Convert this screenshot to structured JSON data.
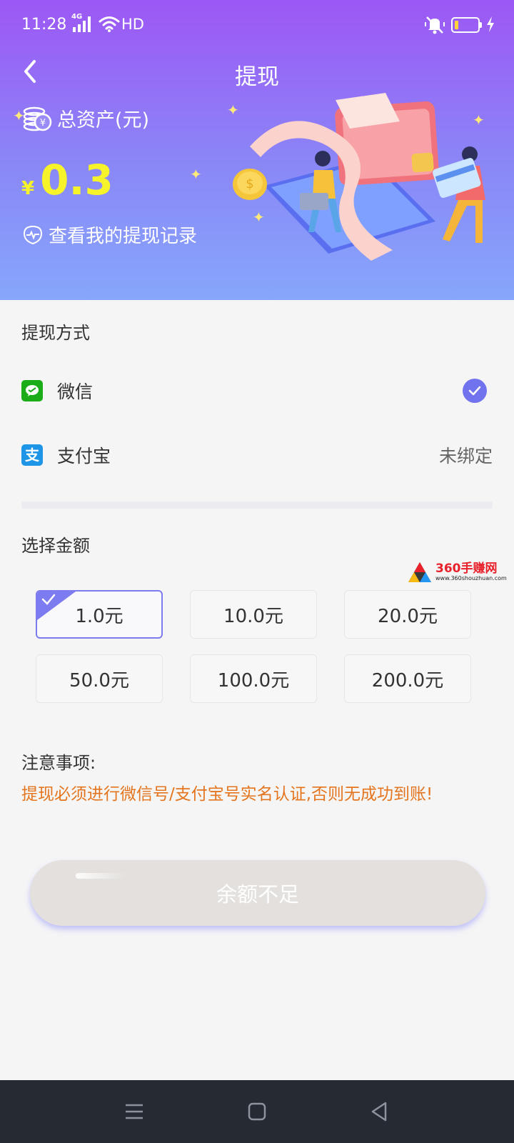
{
  "status_bar": {
    "time": "11:28",
    "network": "4G",
    "hd": "HD"
  },
  "header": {
    "title": "提现",
    "total_assets_label": "总资产(元)",
    "currency_symbol": "¥",
    "balance": "0.3",
    "record_link": "查看我的提现记录"
  },
  "withdraw_method": {
    "section_title": "提现方式",
    "options": [
      {
        "label": "微信",
        "icon": "wechat-icon",
        "selected": true,
        "status": ""
      },
      {
        "label": "支付宝",
        "icon": "alipay-icon",
        "selected": false,
        "status": "未绑定"
      }
    ]
  },
  "amount": {
    "section_title": "选择金额",
    "options": [
      "1.0元",
      "10.0元",
      "20.0元",
      "50.0元",
      "100.0元",
      "200.0元"
    ],
    "selected_index": 0
  },
  "watermark": {
    "brand": "360手赚网",
    "url": "www.360shouzhuan.com"
  },
  "notes": {
    "title": "注意事项:",
    "text": "提现必须进行微信号/支付宝号实名认证,否则无成功到账!"
  },
  "submit_button": {
    "label": "余额不足",
    "enabled": false
  },
  "colors": {
    "header_top": "#9d57f5",
    "header_bottom": "#86a7fb",
    "accent": "#7173ee",
    "balance": "#f6f32a",
    "warning": "#e4751e",
    "wechat": "#1aad19",
    "alipay": "#1e95e6",
    "button_disabled": "#e3e0dd"
  }
}
